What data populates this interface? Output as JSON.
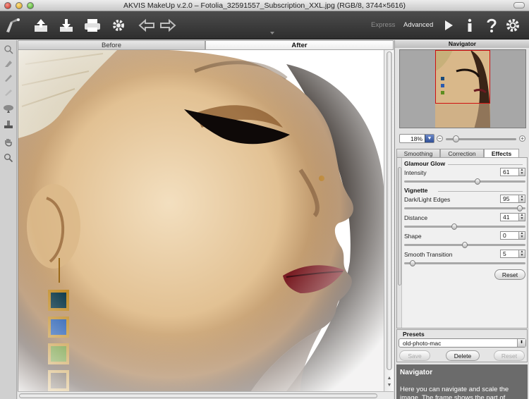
{
  "window": {
    "title": "AKVIS MakeUp v.2.0 – Fotolia_32591557_Subscription_XXL.jpg (RGB/8, 3744×5616)"
  },
  "toolbar": {
    "modes": {
      "express": "Express",
      "advanced": "Advanced"
    },
    "icons": [
      "app-logo-icon",
      "open-icon",
      "save-icon",
      "print-icon",
      "preferences-gear-icon",
      "undo-arrow-icon",
      "redo-arrow-icon",
      "run-icon",
      "info-icon",
      "help-icon",
      "settings-icon"
    ]
  },
  "left_tools": [
    "brush-effect-icon",
    "eraser-icon",
    "history-brush-icon",
    "eye-tool-icon",
    "lip-tool-icon",
    "stamp-icon",
    "hand-icon",
    "zoom-icon"
  ],
  "view_tabs": {
    "before": "Before",
    "after": "After",
    "active": "After"
  },
  "navigator": {
    "title": "Navigator",
    "zoom_value": "18%"
  },
  "settings": {
    "tabs": [
      "Smoothing",
      "Correction",
      "Effects"
    ],
    "active_tab": "Effects",
    "glamour": {
      "title": "Glamour Glow",
      "intensity": {
        "label": "Intensity",
        "value": "61",
        "level": 0.61
      }
    },
    "vignette": {
      "title": "Vignette",
      "edges": {
        "label": "Dark/Light Edges",
        "value": "95",
        "level": 0.975
      },
      "distance": {
        "label": "Distance",
        "value": "41",
        "level": 0.41
      },
      "shape": {
        "label": "Shape",
        "value": "0",
        "level": 0.5
      },
      "smooth": {
        "label": "Smooth Transition",
        "value": "5",
        "level": 0.05
      }
    },
    "reset_label": "Reset"
  },
  "presets": {
    "title": "Presets",
    "selected": "old-photo-mac",
    "save_label": "Save",
    "delete_label": "Delete",
    "reset_label": "Reset"
  },
  "help": {
    "title": "Navigator",
    "text": "Here you can navigate and scale the image. The frame shows the part of"
  },
  "colors": {
    "toolbar": "#3c3c3c",
    "help_bg": "#6b6b6b",
    "accent_blue": "#2f4f97"
  }
}
